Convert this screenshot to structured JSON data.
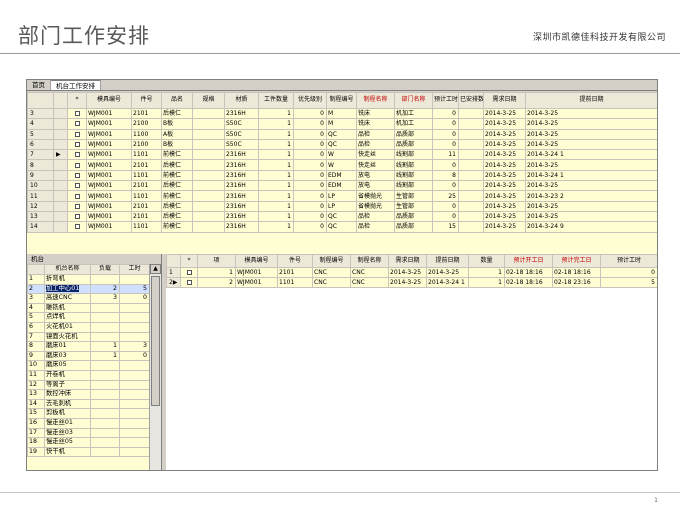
{
  "slide": {
    "title": "部门工作安排",
    "company": "深圳市凯德佳科技开发有限公司",
    "page_number": "1"
  },
  "tabs": [
    {
      "label": "首页",
      "active": false
    },
    {
      "label": "机台工作安排",
      "active": true
    }
  ],
  "top_grid": {
    "headers": [
      "",
      "",
      "*",
      "模具编号",
      "件号",
      "品名",
      "规格",
      "材质",
      "工件数量",
      "优先级别",
      "制程编号",
      "制程名称",
      "部门名称",
      "预计工时",
      "已安排数",
      "需求日期",
      "提前日期"
    ],
    "red_headers": [
      11,
      12
    ],
    "rows": [
      {
        "rn": "3",
        "mark": "",
        "mold": "WJM001",
        "part": "2101",
        "name": "后模仁",
        "spec": "",
        "material": "2316H",
        "qty": "1",
        "prio": "0",
        "proc_no": "M",
        "proc_name": "铣床",
        "dept": "机加工",
        "hours": "0",
        "arranged": "",
        "need": "2014-3-25",
        "early": "2014-3-25"
      },
      {
        "rn": "4",
        "mark": "",
        "mold": "WJM001",
        "part": "2100",
        "name": "B板",
        "spec": "",
        "material": "S50C",
        "qty": "1",
        "prio": "0",
        "proc_no": "M",
        "proc_name": "铣床",
        "dept": "机加工",
        "hours": "0",
        "arranged": "",
        "need": "2014-3-25",
        "early": "2014-3-25"
      },
      {
        "rn": "5",
        "mark": "",
        "mold": "WJM001",
        "part": "1100",
        "name": "A板",
        "spec": "",
        "material": "S50C",
        "qty": "1",
        "prio": "0",
        "proc_no": "QC",
        "proc_name": "品检",
        "dept": "品质部",
        "hours": "0",
        "arranged": "",
        "need": "2014-3-25",
        "early": "2014-3-25"
      },
      {
        "rn": "6",
        "mark": "",
        "mold": "WJM001",
        "part": "2100",
        "name": "B板",
        "spec": "",
        "material": "S50C",
        "qty": "1",
        "prio": "0",
        "proc_no": "QC",
        "proc_name": "品检",
        "dept": "品质部",
        "hours": "0",
        "arranged": "",
        "need": "2014-3-25",
        "early": "2014-3-25"
      },
      {
        "rn": "7",
        "mark": "▶",
        "mold": "WJM001",
        "part": "1101",
        "name": "前模仁",
        "spec": "",
        "material": "2316H",
        "qty": "1",
        "prio": "0",
        "proc_no": "W",
        "proc_name": "快走丝",
        "dept": "线割部",
        "hours": "11",
        "arranged": "",
        "need": "2014-3-25",
        "early": "2014-3-24 1"
      },
      {
        "rn": "8",
        "mark": "",
        "mold": "WJM001",
        "part": "2101",
        "name": "后模仁",
        "spec": "",
        "material": "2316H",
        "qty": "1",
        "prio": "0",
        "proc_no": "W",
        "proc_name": "快走丝",
        "dept": "线割部",
        "hours": "0",
        "arranged": "",
        "need": "2014-3-25",
        "early": "2014-3-25"
      },
      {
        "rn": "9",
        "mark": "",
        "mold": "WJM001",
        "part": "1101",
        "name": "前模仁",
        "spec": "",
        "material": "2316H",
        "qty": "1",
        "prio": "0",
        "proc_no": "EDM",
        "proc_name": "放电",
        "dept": "线割部",
        "hours": "8",
        "arranged": "",
        "need": "2014-3-25",
        "early": "2014-3-24 1"
      },
      {
        "rn": "10",
        "mark": "",
        "mold": "WJM001",
        "part": "2101",
        "name": "后模仁",
        "spec": "",
        "material": "2316H",
        "qty": "1",
        "prio": "0",
        "proc_no": "EDM",
        "proc_name": "放电",
        "dept": "线割部",
        "hours": "0",
        "arranged": "",
        "need": "2014-3-25",
        "early": "2014-3-25"
      },
      {
        "rn": "11",
        "mark": "",
        "mold": "WJM001",
        "part": "1101",
        "name": "前模仁",
        "spec": "",
        "material": "2316H",
        "qty": "1",
        "prio": "0",
        "proc_no": "LP",
        "proc_name": "省模抛光",
        "dept": "生管部",
        "hours": "25",
        "arranged": "",
        "need": "2014-3-25",
        "early": "2014-3-23 2"
      },
      {
        "rn": "12",
        "mark": "",
        "mold": "WJM001",
        "part": "2101",
        "name": "后模仁",
        "spec": "",
        "material": "2316H",
        "qty": "1",
        "prio": "0",
        "proc_no": "LP",
        "proc_name": "省模抛光",
        "dept": "生管部",
        "hours": "0",
        "arranged": "",
        "need": "2014-3-25",
        "early": "2014-3-25"
      },
      {
        "rn": "13",
        "mark": "",
        "mold": "WJM001",
        "part": "2101",
        "name": "后模仁",
        "spec": "",
        "material": "2316H",
        "qty": "1",
        "prio": "0",
        "proc_no": "QC",
        "proc_name": "品检",
        "dept": "品质部",
        "hours": "0",
        "arranged": "",
        "need": "2014-3-25",
        "early": "2014-3-25"
      },
      {
        "rn": "14",
        "mark": "",
        "mold": "WJM001",
        "part": "1101",
        "name": "前模仁",
        "spec": "",
        "material": "2316H",
        "qty": "1",
        "prio": "0",
        "proc_no": "QC",
        "proc_name": "品检",
        "dept": "品质部",
        "hours": "15",
        "arranged": "",
        "need": "2014-3-25",
        "early": "2014-3-24 9"
      }
    ]
  },
  "machine_panel": {
    "caption": "机台",
    "headers": [
      "",
      "机台名称",
      "负载",
      "工时"
    ],
    "rows": [
      {
        "rn": "1",
        "name": "折弯机",
        "load": "",
        "hours": ""
      },
      {
        "rn": "2",
        "name": "加工中心01",
        "load": "2",
        "hours": "5",
        "selected": true
      },
      {
        "rn": "3",
        "name": "高速CNC",
        "load": "3",
        "hours": "0"
      },
      {
        "rn": "4",
        "name": "雕铣机",
        "load": "",
        "hours": ""
      },
      {
        "rn": "5",
        "name": "点焊机",
        "load": "",
        "hours": ""
      },
      {
        "rn": "6",
        "name": "火花机01",
        "load": "",
        "hours": ""
      },
      {
        "rn": "7",
        "name": "镜面火花机",
        "load": "",
        "hours": ""
      },
      {
        "rn": "8",
        "name": "磨床01",
        "load": "1",
        "hours": "3"
      },
      {
        "rn": "9",
        "name": "磨床03",
        "load": "1",
        "hours": "0"
      },
      {
        "rn": "10",
        "name": "磨床05",
        "load": "",
        "hours": ""
      },
      {
        "rn": "11",
        "name": "开卷机",
        "load": "",
        "hours": ""
      },
      {
        "rn": "12",
        "name": "等离子",
        "load": "",
        "hours": ""
      },
      {
        "rn": "13",
        "name": "数控冲床",
        "load": "",
        "hours": ""
      },
      {
        "rn": "14",
        "name": "去毛刺机",
        "load": "",
        "hours": ""
      },
      {
        "rn": "15",
        "name": "剪板机",
        "load": "",
        "hours": ""
      },
      {
        "rn": "16",
        "name": "慢走丝01",
        "load": "",
        "hours": ""
      },
      {
        "rn": "17",
        "name": "慢走丝03",
        "load": "",
        "hours": ""
      },
      {
        "rn": "18",
        "name": "慢走丝05",
        "load": "",
        "hours": ""
      },
      {
        "rn": "19",
        "name": "快干机",
        "load": "",
        "hours": ""
      }
    ],
    "scroll_up": "▲"
  },
  "bottom_grid": {
    "headers": [
      "",
      "*",
      "项",
      "模具编号",
      "件号",
      "制程编号",
      "制程名称",
      "需求日期",
      "提前日期",
      "数量",
      "预计开工日",
      "预计完工日",
      "预计工时"
    ],
    "red_headers": [
      10,
      11
    ],
    "rows": [
      {
        "rn": "1",
        "mark": "",
        "item": "1",
        "mold": "WJM001",
        "part": "2101",
        "proc_no": "CNC",
        "proc_name": "CNC",
        "need": "2014-3-25",
        "early": "2014-3-25",
        "qty": "1",
        "start": "02-18 18:16",
        "end": "02-18 18:16",
        "hours": "0"
      },
      {
        "rn": "2",
        "mark": "▶",
        "item": "2",
        "mold": "WJM001",
        "part": "1101",
        "proc_no": "CNC",
        "proc_name": "CNC",
        "need": "2014-3-25",
        "early": "2014-3-24 1",
        "qty": "1",
        "start": "02-18 18:16",
        "end": "02-18 23:16",
        "hours": "5"
      }
    ]
  }
}
